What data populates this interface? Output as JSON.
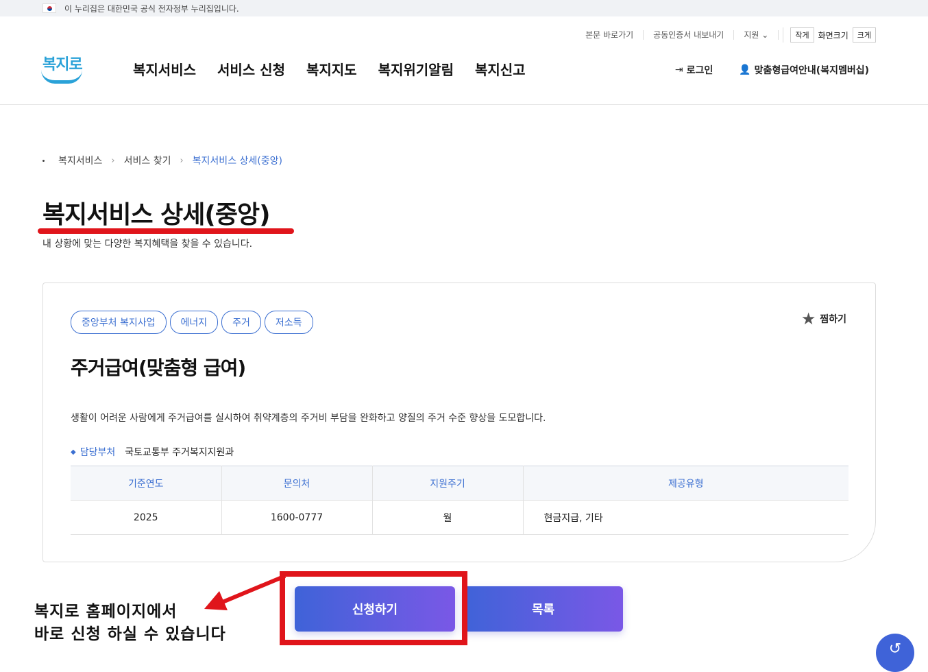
{
  "gov_banner": {
    "text": "이 누리집은 대한민국 공식 전자정부 누리집입니다."
  },
  "utility": {
    "skip_link": "본문 바로가기",
    "cert_export": "공동인증서 내보내기",
    "support": "지원",
    "font_small": "작게",
    "font_label": "화면크기",
    "font_large": "크게"
  },
  "logo": {
    "text": "복지로"
  },
  "gnb": [
    "복지서비스",
    "서비스 신청",
    "복지지도",
    "복지위기알림",
    "복지신고"
  ],
  "header_right": {
    "login": "로그인",
    "member": "맞춤형급여안내(복지멤버십)"
  },
  "breadcrumb": {
    "item1": "복지서비스",
    "item2": "서비스 찾기",
    "current": "복지서비스 상세(중앙)"
  },
  "page": {
    "title": "복지서비스 상세(중앙)",
    "subtitle": "내 상황에 맞는 다양한 복지혜택을 찾을 수 있습니다."
  },
  "service": {
    "tags": [
      "중앙부처 복지사업",
      "에너지",
      "주거",
      "저소득"
    ],
    "favorite": "찜하기",
    "title": "주거급여(맞춤형 급여)",
    "description": "생활이 어려운 사람에게 주거급여를 실시하여 취약계층의 주거비 부담을 완화하고 양질의 주거 수준 향상을 도모합니다.",
    "dept_label": "담당부처",
    "dept_value": "국토교통부 주거복지지원과",
    "table": {
      "headers": [
        "기준연도",
        "문의처",
        "지원주기",
        "제공유형"
      ],
      "row": [
        "2025",
        "1600-0777",
        "월",
        "현금지급, 기타"
      ]
    }
  },
  "buttons": {
    "apply": "신청하기",
    "list": "목록"
  },
  "annotation": {
    "line1": "복지로 홈페이지에서",
    "line2": "바로 신청 하실 수 있습니다"
  },
  "colors": {
    "accent": "#3b6fd1",
    "highlight_red": "#e0151b",
    "button_start": "#3f63d8",
    "button_end": "#7a58e6"
  }
}
